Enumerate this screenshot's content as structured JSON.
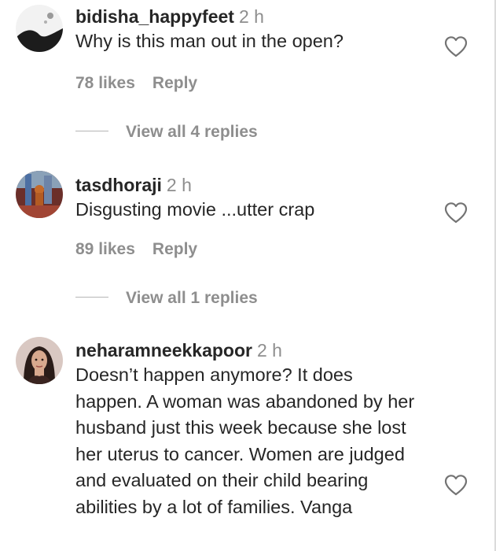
{
  "comments": [
    {
      "username": "bidisha_happyfeet",
      "time": "2 h",
      "text": "Why is this man out in the open?",
      "likes": "78 likes",
      "reply": "Reply",
      "view_replies": "View all 4 replies"
    },
    {
      "username": "tasdhoraji",
      "time": "2 h",
      "text": "Disgusting movie ...utter crap",
      "likes": "89 likes",
      "reply": "Reply",
      "view_replies": "View all 1 replies"
    },
    {
      "username": "neharamneekkapoor",
      "time": "2 h",
      "text": "Doesn’t happen anymore? It does happen. A woman was abandoned by her husband just this week because she lost her uterus to cancer. Women are judged and evaluated on their child bearing abilities by a lot of families. Vanga"
    }
  ],
  "icons": {
    "like": "heart-outline-icon"
  },
  "colors": {
    "primary_text": "#262626",
    "secondary_text": "#8e8e8e",
    "divider": "#dbdbdb"
  }
}
